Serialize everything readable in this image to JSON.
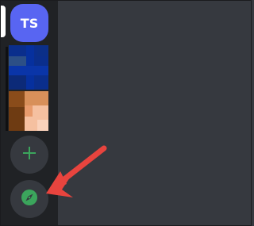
{
  "sidebar": {
    "servers": [
      {
        "initials": "TS",
        "color": "#5865f2",
        "selected": true
      },
      {
        "type": "image",
        "colors": [
          "#0a2e8c",
          "#2a4f8c",
          "#1f3f7a"
        ]
      },
      {
        "type": "image",
        "colors": [
          "#b26a2a",
          "#f4b79a",
          "#6e3b12"
        ]
      }
    ],
    "add_server": {
      "icon": "plus-icon",
      "color": "#3ba55c"
    },
    "explore_servers": {
      "icon": "compass-icon",
      "color": "#3ba55c"
    }
  },
  "annotation": {
    "icon": "arrow-icon",
    "color": "#e8443e"
  }
}
